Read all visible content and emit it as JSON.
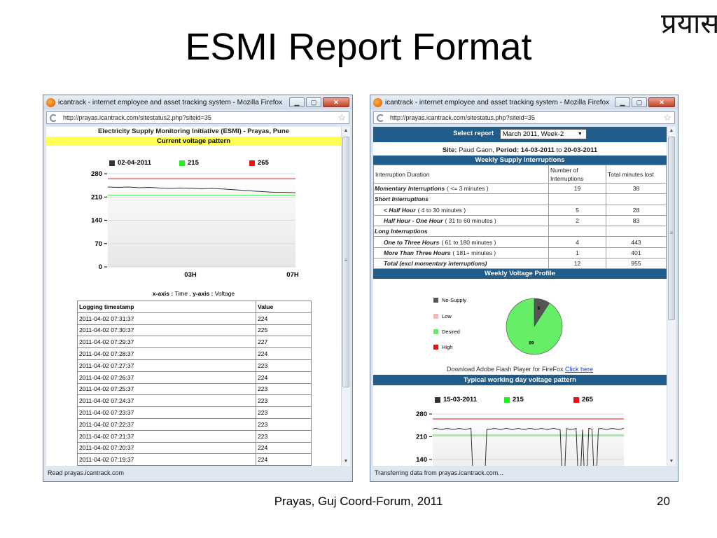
{
  "slide": {
    "title": "ESMI Report Format",
    "logo_text": "प्रयास",
    "footer": "Prayas, Guj Coord-Forum, 2011",
    "page_number": "20"
  },
  "left_window": {
    "title": "icantrack - internet employee and asset tracking system - Mozilla Firefox",
    "url": "http://prayas.icantrack.com/sitestatus2.php?siteid=35",
    "heading": "Electricity Supply Monitoring Initiative (ESMI) - Prayas, Pune",
    "subheading": "Current voltage pattern",
    "status": "Read prayas.icantrack.com",
    "chart_data": {
      "type": "line",
      "legend": [
        {
          "label": "02-04-2011",
          "color": "#333333"
        },
        {
          "label": "215",
          "color": "#22ee22"
        },
        {
          "label": "265",
          "color": "#ee1111"
        }
      ],
      "yticks": [
        "280",
        "210",
        "140",
        "70",
        "0"
      ],
      "xticks": [
        "03H",
        "07H"
      ],
      "ylim": [
        0,
        280
      ],
      "reference_lines": [
        215,
        265
      ],
      "series": [
        {
          "values": [
            240,
            239,
            240,
            238,
            239,
            237,
            236,
            237,
            236,
            235,
            236,
            234,
            232,
            230,
            228,
            226,
            224,
            224,
            223
          ]
        }
      ],
      "xlabel": "Time",
      "ylabel": "Voltage"
    },
    "caption_x_label": "x-axis :",
    "caption_x_value": "Time",
    "caption_sep": ",",
    "caption_y_label": "y-axis :",
    "caption_y_value": "Voltage",
    "table": {
      "headers": [
        "Logging timestamp",
        "Value"
      ],
      "rows": [
        [
          "2011-04-02 07:31:37",
          "224"
        ],
        [
          "2011-04-02 07:30:37",
          "225"
        ],
        [
          "2011-04-02 07:29:37",
          "227"
        ],
        [
          "2011-04-02 07:28:37",
          "224"
        ],
        [
          "2011-04-02 07:27:37",
          "223"
        ],
        [
          "2011-04-02 07:26:37",
          "224"
        ],
        [
          "2011-04-02 07:25:37",
          "223"
        ],
        [
          "2011-04-02 07:24:37",
          "223"
        ],
        [
          "2011-04-02 07:23:37",
          "223"
        ],
        [
          "2011-04-02 07:22:37",
          "223"
        ],
        [
          "2011-04-02 07:21:37",
          "223"
        ],
        [
          "2011-04-02 07:20:37",
          "224"
        ],
        [
          "2011-04-02 07:19:37",
          "224"
        ]
      ]
    }
  },
  "right_window": {
    "title": "icantrack - internet employee and asset tracking system - Mozilla Firefox",
    "url": "http://prayas.icantrack.com/sitestatus.php?siteid=35",
    "select_label": "Select report",
    "select_value": "March 2011, Week-2",
    "site_label": "Site:",
    "site_value": "Paud Gaon,",
    "period_label": "Period:",
    "period_from": "14-03-2011",
    "period_to_word": "to",
    "period_to": "20-03-2011",
    "weekly_interruptions_title": "Weekly Supply Interruptions",
    "interruptions_table": {
      "headers": [
        "Interruption Duration",
        "Number of Interruptions",
        "Total minutes lost"
      ],
      "rows": [
        {
          "name": "Momentary Interruptions",
          "range": "( <= 3 minutes )",
          "count": "19",
          "minutes": "38",
          "indent": 0,
          "italic_bold": true
        },
        {
          "name": "Short Interruptions",
          "range": "",
          "count": "",
          "minutes": "",
          "indent": 0,
          "italic_bold": true
        },
        {
          "name": "< Half Hour",
          "range": "( 4 to 30 minutes )",
          "count": "5",
          "minutes": "28",
          "indent": 1,
          "italic_bold": true
        },
        {
          "name": "Half Hour - One Hour",
          "range": "( 31 to 60 minutes )",
          "count": "2",
          "minutes": "83",
          "indent": 1,
          "italic_bold": true
        },
        {
          "name": "Long Interruptions",
          "range": "",
          "count": "",
          "minutes": "",
          "indent": 0,
          "italic_bold": true
        },
        {
          "name": "One to Three Hours",
          "range": "( 61 to 180 minutes )",
          "count": "4",
          "minutes": "443",
          "indent": 1,
          "italic_bold": true
        },
        {
          "name": "More Than Three Hours",
          "range": "( 181+ minutes )",
          "count": "1",
          "minutes": "401",
          "indent": 1,
          "italic_bold": true
        },
        {
          "name": "Total (excl momentary interruptions)",
          "range": "",
          "count": "12",
          "minutes": "955",
          "indent": 1,
          "italic_bold": true
        }
      ]
    },
    "weekly_voltage_title": "Weekly Voltage Profile",
    "pie_chart_data": {
      "type": "pie",
      "legend": [
        {
          "label": "No-Supply",
          "color": "#555555"
        },
        {
          "label": "Low",
          "color": "#f4b8b8"
        },
        {
          "label": "Desired",
          "color": "#66ee66"
        },
        {
          "label": "High",
          "color": "#ee1111"
        }
      ],
      "slices": [
        {
          "label": "No-Supply",
          "value": 9,
          "color": "#555555"
        },
        {
          "label": "Desired",
          "value": 89,
          "color": "#66ee66"
        }
      ]
    },
    "flash_note": "Download Adobe Flash Player for FireFox",
    "flash_link": "Click here",
    "typical_day_title": "Typical working day voltage pattern",
    "typical_chart_data": {
      "type": "line",
      "legend": [
        {
          "label": "15-03-2011",
          "color": "#333333"
        },
        {
          "label": "215",
          "color": "#22ee22"
        },
        {
          "label": "265",
          "color": "#ee1111"
        }
      ],
      "yticks": [
        "280",
        "210",
        "140"
      ],
      "ylim": [
        0,
        280
      ],
      "reference_lines": [
        215,
        265
      ]
    },
    "status": "Transferring data from prayas.icantrack.com..."
  }
}
